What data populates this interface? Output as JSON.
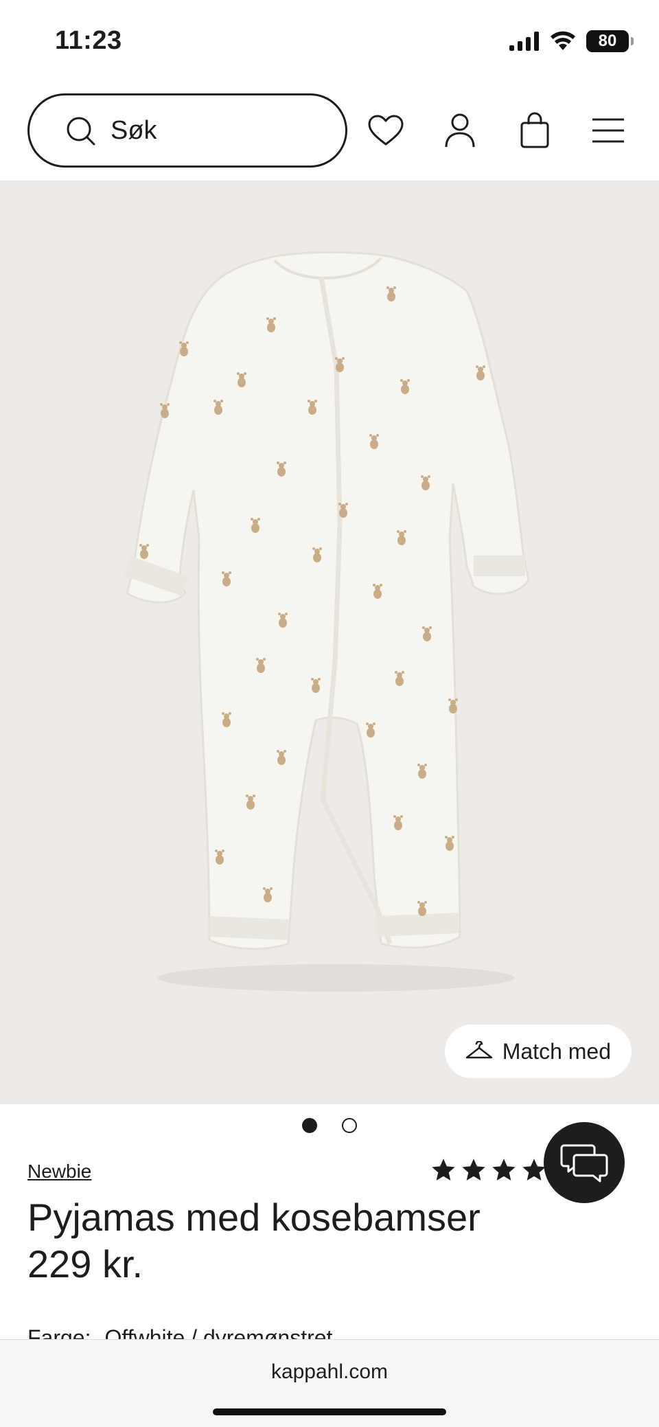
{
  "status_bar": {
    "time": "11:23",
    "battery": "80"
  },
  "header": {
    "search_placeholder": "Søk",
    "icons": [
      "search-icon",
      "heart-icon",
      "user-icon",
      "shopping-bag-icon",
      "menu-icon"
    ]
  },
  "gallery": {
    "match_button_label": "Match med",
    "image_count": 2,
    "active_index": 0
  },
  "product": {
    "brand": "Newbie",
    "title": "Pyjamas med kosebamser",
    "price": "229 kr.",
    "rating_stars": 4,
    "color_label": "Farge:",
    "color_value": "Offwhite / dyremønstret"
  },
  "browser": {
    "url": "kappahl.com"
  }
}
